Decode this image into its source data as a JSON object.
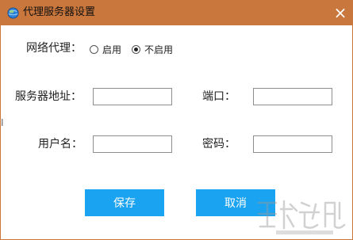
{
  "window": {
    "title": "代理服务器设置",
    "close_glyph": "×"
  },
  "proxy": {
    "label": "网络代理：",
    "options": [
      "启用",
      "不启用"
    ],
    "selected": "不启用"
  },
  "fields": {
    "server_label": "服务器地址：",
    "server_value": "",
    "port_label": "端口：",
    "port_value": "",
    "username_label": "用户名：",
    "username_value": "",
    "password_label": "密码：",
    "password_value": ""
  },
  "buttons": {
    "save": "保存",
    "cancel": "取消"
  },
  "colors": {
    "titlebar": "#c9773c",
    "button": "#1aa3f0"
  },
  "left_mark": "I",
  "watermark_icon": "watermark-logo-icon"
}
